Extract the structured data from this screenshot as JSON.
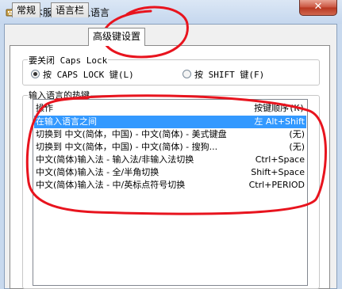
{
  "window": {
    "title": "文本服务和输入语言",
    "close_glyph": "✕"
  },
  "tabs": [
    {
      "label": "常规"
    },
    {
      "label": "语言栏"
    },
    {
      "label": "高级键设置"
    }
  ],
  "caps_group": {
    "label": "要关闭 Caps Lock",
    "options": [
      {
        "label": "按 CAPS LOCK 键(L)",
        "selected": true
      },
      {
        "label": "按 SHIFT 键(F)",
        "selected": false
      }
    ]
  },
  "hotkeys_group": {
    "label": "输入语言的热键",
    "columns": {
      "action": "操作",
      "key": "按键顺序(K)"
    },
    "rows": [
      {
        "action": "在输入语言之间",
        "key": "左 Alt+Shift",
        "selected": true
      },
      {
        "action": "切换到 中文(简体，中国) - 中文(简体) - 美式键盘",
        "key": "(无)",
        "selected": false
      },
      {
        "action": "切换到 中文(简体，中国) - 中文(简体) - 搜狗...",
        "key": "(无)",
        "selected": false
      },
      {
        "action": "中文(简体)输入法 - 输入法/非输入法切换",
        "key": "Ctrl+Space",
        "selected": false
      },
      {
        "action": "中文(简体)输入法 - 全/半角切换",
        "key": "Shift+Space",
        "selected": false
      },
      {
        "action": "中文(简体)输入法 - 中/英标点符号切换",
        "key": "Ctrl+PERIOD",
        "selected": false
      }
    ]
  },
  "colors": {
    "selection": "#3399ff",
    "annotation": "#e8141e"
  }
}
